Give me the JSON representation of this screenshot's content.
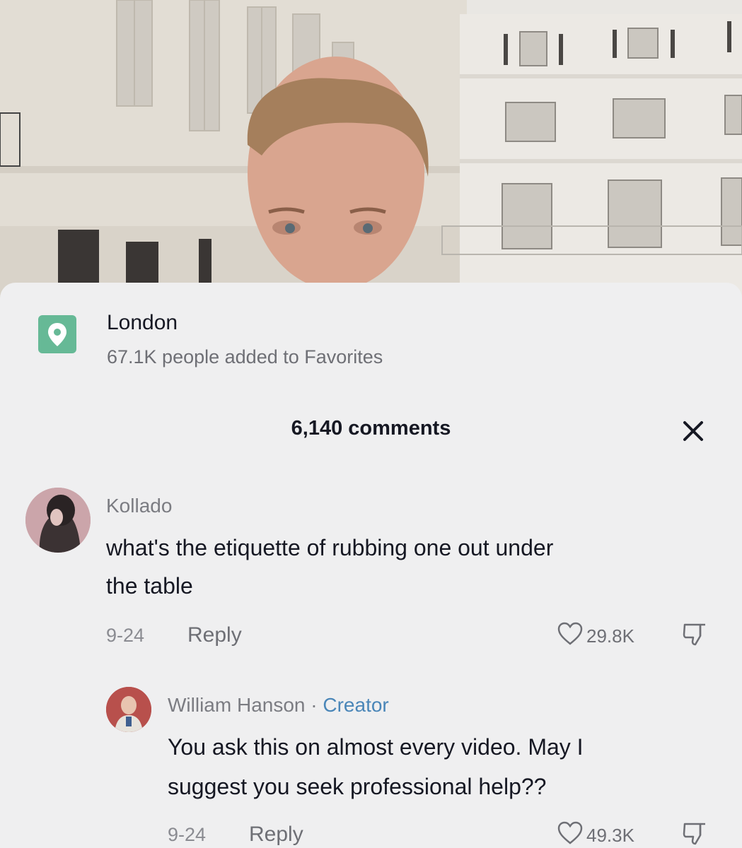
{
  "location": {
    "icon": "map-pin-icon",
    "title": "London",
    "subtitle": "67.1K people added to Favorites"
  },
  "comments_header": {
    "count_label": "6,140 comments",
    "close_icon": "close-icon"
  },
  "comments": [
    {
      "username": "Kollado",
      "text_line1": "what's the etiquette of rubbing one out under",
      "text_line2": "the table",
      "date": "9-24",
      "reply_label": "Reply",
      "likes": "29.8K"
    },
    {
      "username": "William Hanson",
      "separator": " · ",
      "role_badge": "Creator",
      "text_line1": "You ask this on almost every video. May I",
      "text_line2": "suggest you seek professional help??",
      "date": "9-24",
      "reply_label": "Reply",
      "likes": "49.3K"
    }
  ],
  "colors": {
    "location_icon_bg": "#66b996",
    "creator_badge": "#4a86b8",
    "sheet_bg": "#efeff0"
  }
}
